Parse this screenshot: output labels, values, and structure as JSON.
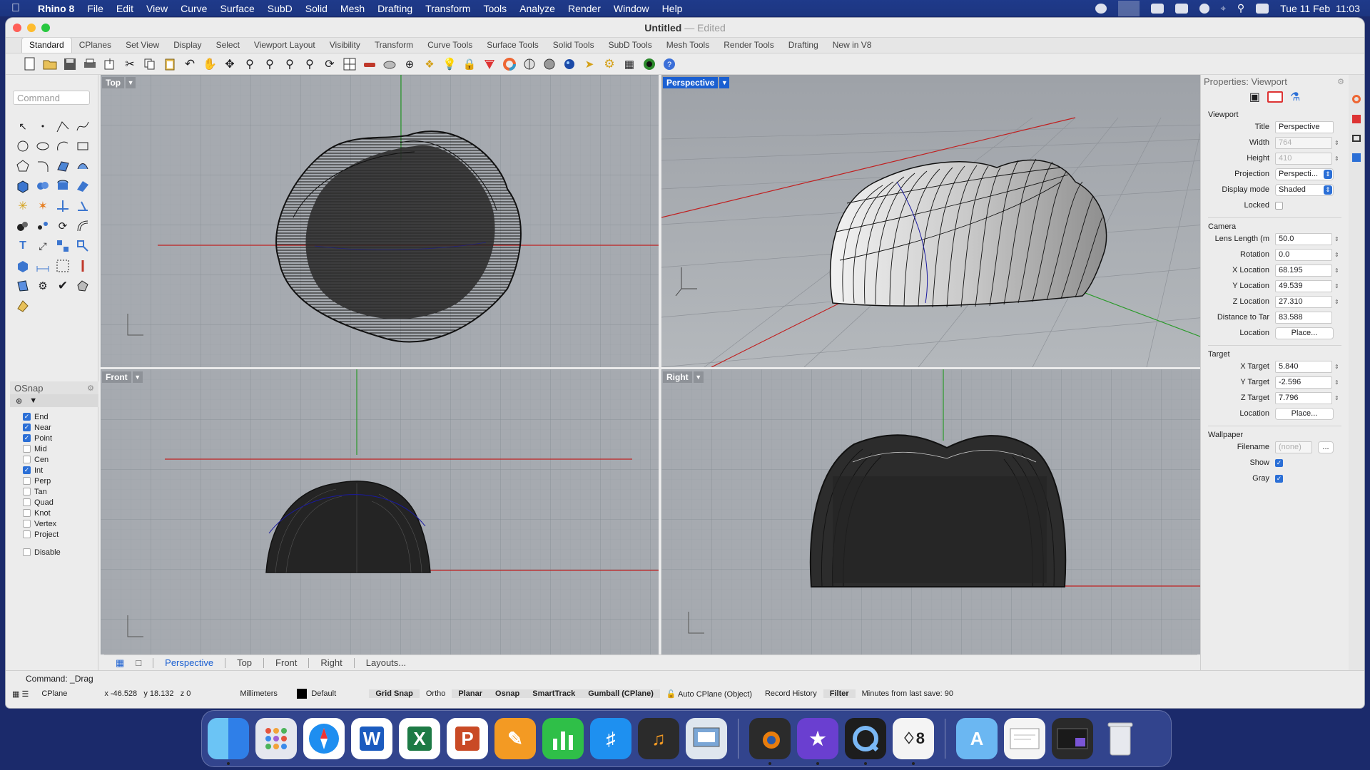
{
  "menubar": {
    "app_name": "Rhino 8",
    "items": [
      "File",
      "Edit",
      "View",
      "Curve",
      "Surface",
      "SubD",
      "Solid",
      "Mesh",
      "Drafting",
      "Transform",
      "Tools",
      "Analyze",
      "Render",
      "Window",
      "Help"
    ],
    "clock": "Tue 11 Feb  11:03"
  },
  "window": {
    "title": "Untitled",
    "edited": "— Edited"
  },
  "ribbon_tabs": [
    "Standard",
    "CPlanes",
    "Set View",
    "Display",
    "Select",
    "Viewport Layout",
    "Visibility",
    "Transform",
    "Curve Tools",
    "Surface Tools",
    "Solid Tools",
    "SubD Tools",
    "Mesh Tools",
    "Render Tools",
    "Drafting",
    "New in V8"
  ],
  "command_placeholder": "Command",
  "osnap": {
    "title": "OSnap",
    "items": [
      {
        "label": "End",
        "checked": true
      },
      {
        "label": "Near",
        "checked": true
      },
      {
        "label": "Point",
        "checked": true
      },
      {
        "label": "Mid",
        "checked": false
      },
      {
        "label": "Cen",
        "checked": false
      },
      {
        "label": "Int",
        "checked": true
      },
      {
        "label": "Perp",
        "checked": false
      },
      {
        "label": "Tan",
        "checked": false
      },
      {
        "label": "Quad",
        "checked": false
      },
      {
        "label": "Knot",
        "checked": false
      },
      {
        "label": "Vertex",
        "checked": false
      },
      {
        "label": "Project",
        "checked": false
      }
    ],
    "disable_label": "Disable"
  },
  "viewports": {
    "top": "Top",
    "perspective": "Perspective",
    "front": "Front",
    "right": "Right"
  },
  "viewport_tabs": [
    "Perspective",
    "Top",
    "Front",
    "Right",
    "Layouts..."
  ],
  "properties": {
    "header": "Properties: Viewport",
    "viewport_section": "Viewport",
    "title_label": "Title",
    "title_value": "Perspective",
    "width_label": "Width",
    "width_value": "764",
    "height_label": "Height",
    "height_value": "410",
    "projection_label": "Projection",
    "projection_value": "Perspecti...",
    "display_mode_label": "Display mode",
    "display_mode_value": "Shaded",
    "locked_label": "Locked",
    "camera_section": "Camera",
    "lens_label": "Lens Length (m",
    "lens_value": "50.0",
    "rotation_label": "Rotation",
    "rotation_value": "0.0",
    "xloc_label": "X Location",
    "xloc_value": "68.195",
    "yloc_label": "Y Location",
    "yloc_value": "49.539",
    "zloc_label": "Z Location",
    "zloc_value": "27.310",
    "dist_label": "Distance to Tar",
    "dist_value": "83.588",
    "cam_location_label": "Location",
    "place_button": "Place...",
    "target_section": "Target",
    "xtgt_label": "X Target",
    "xtgt_value": "5.840",
    "ytgt_label": "Y Target",
    "ytgt_value": "-2.596",
    "ztgt_label": "Z Target",
    "ztgt_value": "7.796",
    "tgt_location_label": "Location",
    "wallpaper_section": "Wallpaper",
    "filename_label": "Filename",
    "filename_value": "(none)",
    "browse_button": "...",
    "show_label": "Show",
    "gray_label": "Gray"
  },
  "command_history": "Command: _Drag",
  "status": {
    "cplane": "CPlane",
    "coords": "x -46.528   y 18.132   z 0",
    "units": "Millimeters",
    "layer": "Default",
    "grid_snap": "Grid Snap",
    "ortho": "Ortho",
    "planar": "Planar",
    "osnap": "Osnap",
    "smarttrack": "SmartTrack",
    "gumball": "Gumball (CPlane)",
    "auto_cplane": "Auto CPlane (Object)",
    "record_history": "Record History",
    "filter": "Filter",
    "save_info": "Minutes from last save: 90"
  },
  "dock_apps": [
    "finder-icon",
    "launchpad-icon",
    "safari-icon",
    "word-icon",
    "excel-icon",
    "powerpoint-icon",
    "pages-icon",
    "numbers-icon",
    "keynote-icon",
    "garageband-icon",
    "preview-icon",
    "blender-icon",
    "imovie-icon",
    "quicktime-icon",
    "rhino-icon",
    "appstore-folder-icon",
    "document-icon",
    "terminal-icon",
    "trash-icon"
  ],
  "colors": {
    "accent": "#1a5fd1",
    "viewport_bg": "#a6aab0",
    "menubar": "#1f3a8a"
  }
}
